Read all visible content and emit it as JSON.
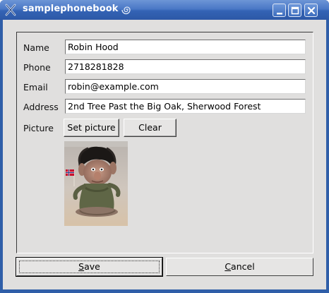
{
  "window": {
    "title": "samplephonebook"
  },
  "form": {
    "name_label": "Name",
    "name_value": "Robin Hood",
    "phone_label": "Phone",
    "phone_value": "2718281828",
    "email_label": "Email",
    "email_value": "robin@example.com",
    "address_label": "Address",
    "address_value": "2nd Tree Past the Big Oak, Sherwood Forest",
    "picture_label": "Picture",
    "set_picture_label": "Set picture",
    "clear_label": "Clear"
  },
  "actions": {
    "save_accel": "S",
    "save_rest": "ave",
    "cancel_accel": "C",
    "cancel_rest": "ancel"
  },
  "icons": {
    "app": "x-app-icon",
    "title_extra": "spiral-icon",
    "minimize": "minimize-icon",
    "maximize": "maximize-icon",
    "close": "close-icon"
  },
  "colors": {
    "titlebar": "#3463b5",
    "window_bg": "#e0dfde"
  }
}
